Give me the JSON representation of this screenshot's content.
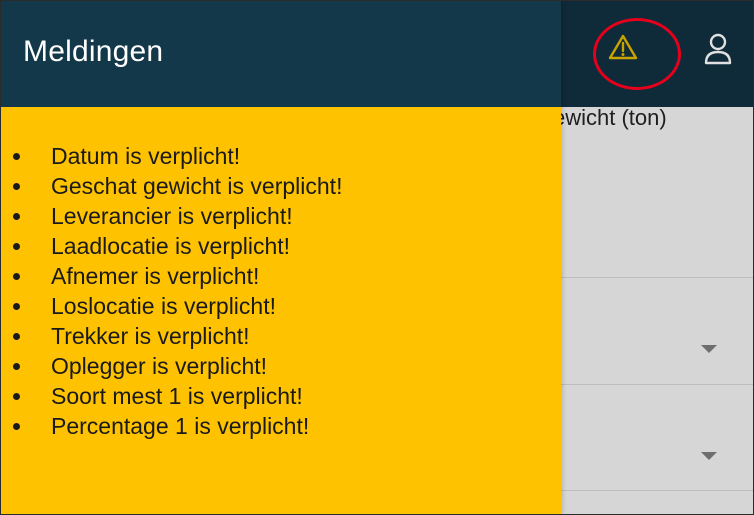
{
  "panel": {
    "title": "Meldingen",
    "messages": [
      "Datum is verplicht!",
      "Geschat gewicht is verplicht!",
      "Leverancier is verplicht!",
      "Laadlocatie is verplicht!",
      "Afnemer is verplicht!",
      "Loslocatie is verplicht!",
      "Trekker is verplicht!",
      "Oplegger is verplicht!",
      "Soort mest 1 is verplicht!",
      "Percentage 1 is verplicht!"
    ]
  },
  "background": {
    "column_header": "ewicht (ton)"
  },
  "icons": {
    "warning": "warning-icon",
    "user": "user-icon",
    "dropdown": "chevron-down-icon"
  },
  "colors": {
    "panel_background": "#ffc200",
    "header_background": "#13384a",
    "appbar_background": "#0f2a38",
    "warning_icon": "#c9a400",
    "highlight_ring": "#e5001c"
  }
}
